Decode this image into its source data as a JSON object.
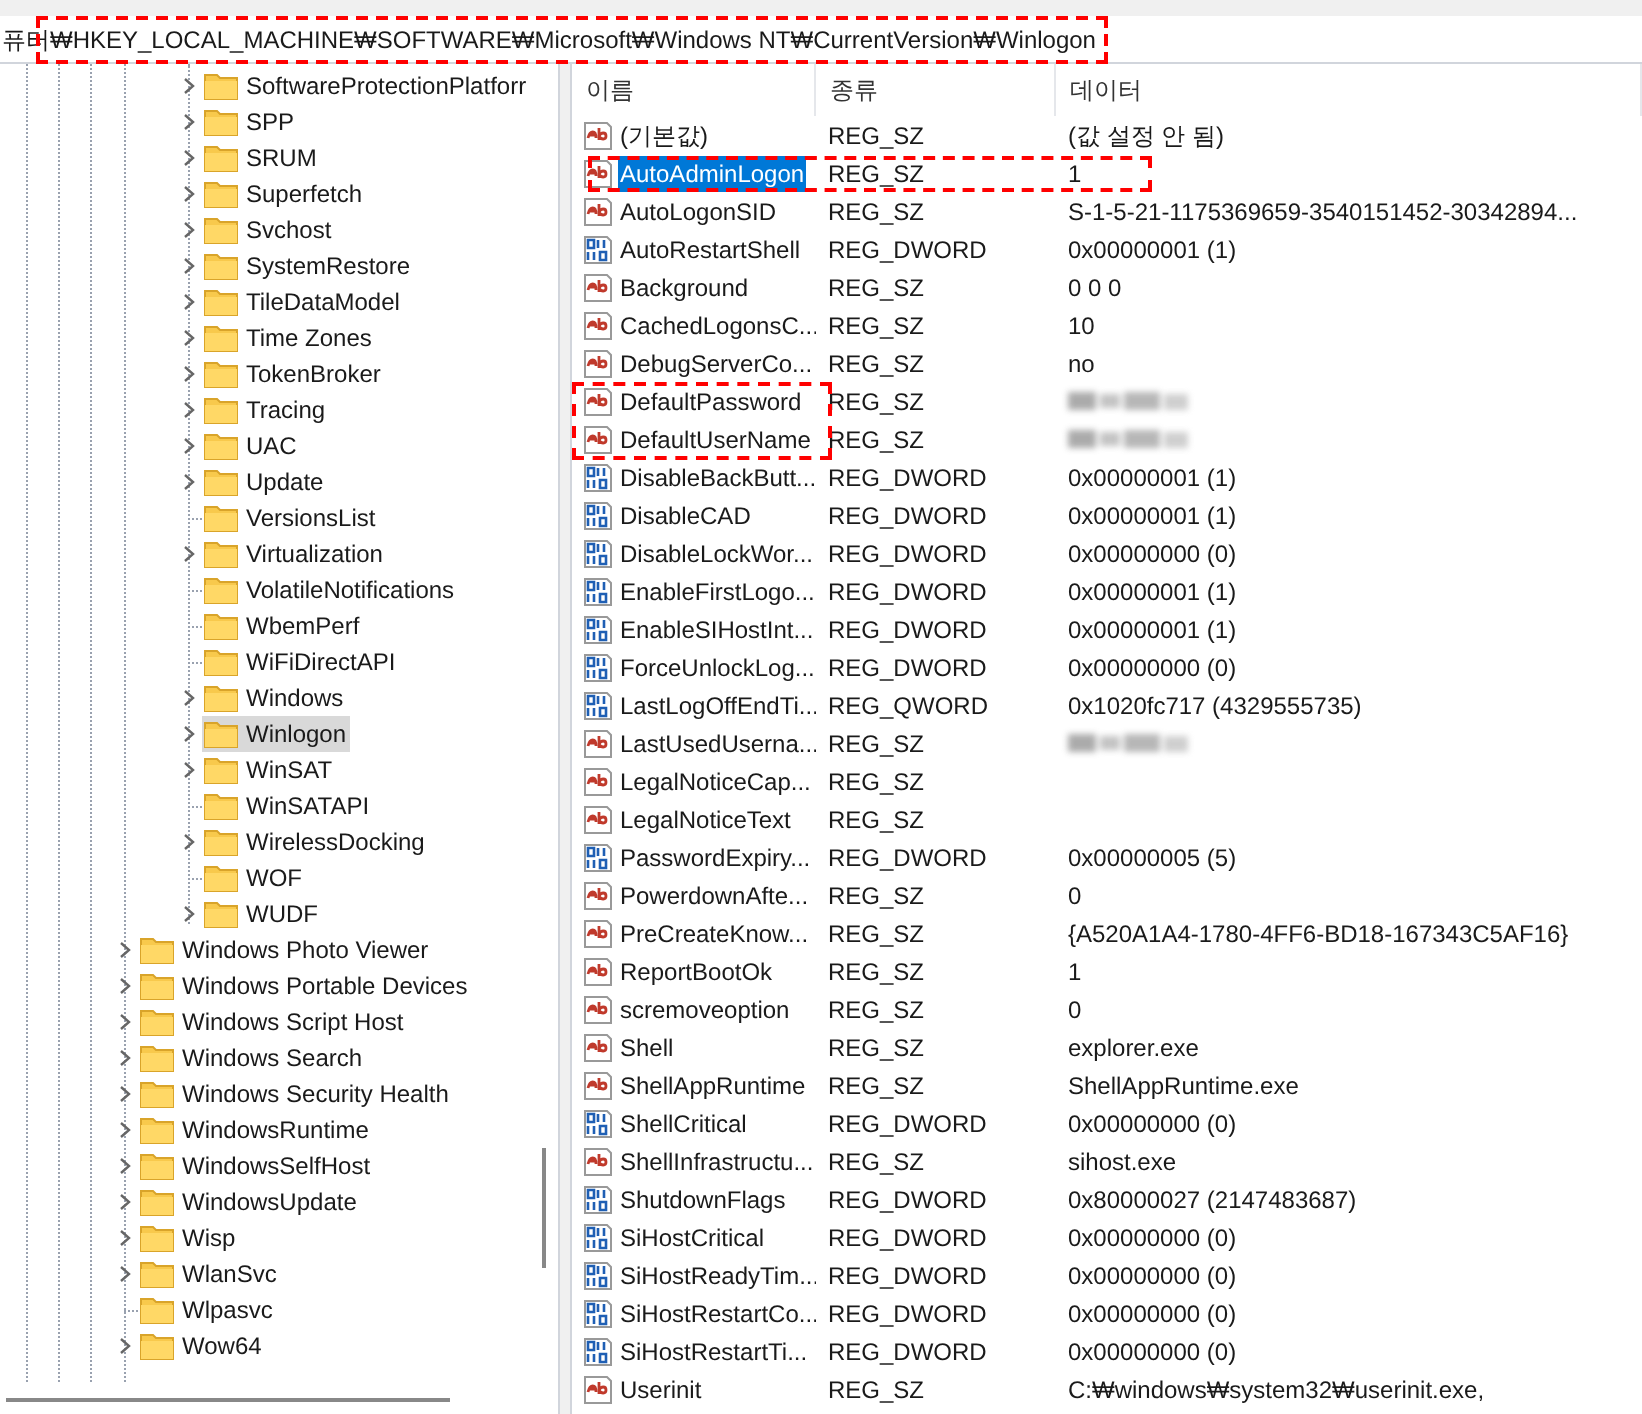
{
  "address_bar": {
    "path": "퓨터₩HKEY_LOCAL_MACHINE₩SOFTWARE₩Microsoft₩Windows NT₩CurrentVersion₩Winlogon",
    "highlighted": true
  },
  "tree": {
    "nested_items": [
      {
        "label": "SoftwareProtectionPlatforr",
        "expandable": true,
        "selected": false
      },
      {
        "label": "SPP",
        "expandable": true,
        "selected": false
      },
      {
        "label": "SRUM",
        "expandable": true,
        "selected": false
      },
      {
        "label": "Superfetch",
        "expandable": true,
        "selected": false
      },
      {
        "label": "Svchost",
        "expandable": true,
        "selected": false
      },
      {
        "label": "SystemRestore",
        "expandable": true,
        "selected": false
      },
      {
        "label": "TileDataModel",
        "expandable": true,
        "selected": false
      },
      {
        "label": "Time Zones",
        "expandable": true,
        "selected": false
      },
      {
        "label": "TokenBroker",
        "expandable": true,
        "selected": false
      },
      {
        "label": "Tracing",
        "expandable": true,
        "selected": false
      },
      {
        "label": "UAC",
        "expandable": true,
        "selected": false
      },
      {
        "label": "Update",
        "expandable": true,
        "selected": false
      },
      {
        "label": "VersionsList",
        "expandable": false,
        "selected": false
      },
      {
        "label": "Virtualization",
        "expandable": true,
        "selected": false
      },
      {
        "label": "VolatileNotifications",
        "expandable": false,
        "selected": false
      },
      {
        "label": "WbemPerf",
        "expandable": false,
        "selected": false
      },
      {
        "label": "WiFiDirectAPI",
        "expandable": false,
        "selected": false
      },
      {
        "label": "Windows",
        "expandable": true,
        "selected": false
      },
      {
        "label": "Winlogon",
        "expandable": true,
        "selected": true
      },
      {
        "label": "WinSAT",
        "expandable": true,
        "selected": false
      },
      {
        "label": "WinSATAPI",
        "expandable": false,
        "selected": false
      },
      {
        "label": "WirelessDocking",
        "expandable": true,
        "selected": false
      },
      {
        "label": "WOF",
        "expandable": false,
        "selected": false
      },
      {
        "label": "WUDF",
        "expandable": true,
        "selected": false
      }
    ],
    "items": [
      {
        "label": "Windows Photo Viewer",
        "expandable": true,
        "selected": false
      },
      {
        "label": "Windows Portable Devices",
        "expandable": true,
        "selected": false
      },
      {
        "label": "Windows Script Host",
        "expandable": true,
        "selected": false
      },
      {
        "label": "Windows Search",
        "expandable": true,
        "selected": false
      },
      {
        "label": "Windows Security Health",
        "expandable": true,
        "selected": false
      },
      {
        "label": "WindowsRuntime",
        "expandable": true,
        "selected": false
      },
      {
        "label": "WindowsSelfHost",
        "expandable": true,
        "selected": false
      },
      {
        "label": "WindowsUpdate",
        "expandable": true,
        "selected": false
      },
      {
        "label": "Wisp",
        "expandable": true,
        "selected": false
      },
      {
        "label": "WlanSvc",
        "expandable": true,
        "selected": false
      },
      {
        "label": "Wlpasvc",
        "expandable": false,
        "selected": false
      },
      {
        "label": "Wow64",
        "expandable": true,
        "selected": false
      }
    ]
  },
  "values": {
    "columns": [
      "이름",
      "종류",
      "데이터"
    ],
    "rows": [
      {
        "kind": "string",
        "name": "(기본값)",
        "type": "REG_SZ",
        "data": "(값 설정 안 됨)",
        "selected": false
      },
      {
        "kind": "string",
        "name": "AutoAdminLogon",
        "type": "REG_SZ",
        "data": "1",
        "selected": true,
        "highlight_row": true
      },
      {
        "kind": "string",
        "name": "AutoLogonSID",
        "type": "REG_SZ",
        "data": "S-1-5-21-1175369659-3540151452-30342894...",
        "selected": false
      },
      {
        "kind": "binary",
        "name": "AutoRestartShell",
        "type": "REG_DWORD",
        "data": "0x00000001 (1)",
        "selected": false
      },
      {
        "kind": "string",
        "name": "Background",
        "type": "REG_SZ",
        "data": "0 0 0",
        "selected": false
      },
      {
        "kind": "string",
        "name": "CachedLogonsC...",
        "type": "REG_SZ",
        "data": "10",
        "selected": false
      },
      {
        "kind": "string",
        "name": "DebugServerCo...",
        "type": "REG_SZ",
        "data": "no",
        "selected": false
      },
      {
        "kind": "string",
        "name": "DefaultPassword",
        "type": "REG_SZ",
        "data_redacted": true,
        "selected": false,
        "highlight_name": true
      },
      {
        "kind": "string",
        "name": "DefaultUserName",
        "type": "REG_SZ",
        "data_redacted": true,
        "selected": false,
        "highlight_name": true
      },
      {
        "kind": "binary",
        "name": "DisableBackButt...",
        "type": "REG_DWORD",
        "data": "0x00000001 (1)",
        "selected": false
      },
      {
        "kind": "binary",
        "name": "DisableCAD",
        "type": "REG_DWORD",
        "data": "0x00000001 (1)",
        "selected": false
      },
      {
        "kind": "binary",
        "name": "DisableLockWor...",
        "type": "REG_DWORD",
        "data": "0x00000000 (0)",
        "selected": false
      },
      {
        "kind": "binary",
        "name": "EnableFirstLogo...",
        "type": "REG_DWORD",
        "data": "0x00000001 (1)",
        "selected": false
      },
      {
        "kind": "binary",
        "name": "EnableSIHostInt...",
        "type": "REG_DWORD",
        "data": "0x00000001 (1)",
        "selected": false
      },
      {
        "kind": "binary",
        "name": "ForceUnlockLog...",
        "type": "REG_DWORD",
        "data": "0x00000000 (0)",
        "selected": false
      },
      {
        "kind": "binary",
        "name": "LastLogOffEndTi...",
        "type": "REG_QWORD",
        "data": "0x1020fc717 (4329555735)",
        "selected": false
      },
      {
        "kind": "string",
        "name": "LastUsedUserna...",
        "type": "REG_SZ",
        "data_redacted": true,
        "selected": false
      },
      {
        "kind": "string",
        "name": "LegalNoticeCap...",
        "type": "REG_SZ",
        "selected": false
      },
      {
        "kind": "string",
        "name": "LegalNoticeText",
        "type": "REG_SZ",
        "selected": false
      },
      {
        "kind": "binary",
        "name": "PasswordExpiry...",
        "type": "REG_DWORD",
        "data": "0x00000005 (5)",
        "selected": false
      },
      {
        "kind": "string",
        "name": "PowerdownAfte...",
        "type": "REG_SZ",
        "data": "0",
        "selected": false
      },
      {
        "kind": "string",
        "name": "PreCreateKnow...",
        "type": "REG_SZ",
        "data": "{A520A1A4-1780-4FF6-BD18-167343C5AF16}",
        "selected": false
      },
      {
        "kind": "string",
        "name": "ReportBootOk",
        "type": "REG_SZ",
        "data": "1",
        "selected": false
      },
      {
        "kind": "string",
        "name": "scremoveoption",
        "type": "REG_SZ",
        "data": "0",
        "selected": false
      },
      {
        "kind": "string",
        "name": "Shell",
        "type": "REG_SZ",
        "data": "explorer.exe",
        "selected": false
      },
      {
        "kind": "string",
        "name": "ShellAppRuntime",
        "type": "REG_SZ",
        "data": "ShellAppRuntime.exe",
        "selected": false
      },
      {
        "kind": "binary",
        "name": "ShellCritical",
        "type": "REG_DWORD",
        "data": "0x00000000 (0)",
        "selected": false
      },
      {
        "kind": "string",
        "name": "ShellInfrastructu...",
        "type": "REG_SZ",
        "data": "sihost.exe",
        "selected": false
      },
      {
        "kind": "binary",
        "name": "ShutdownFlags",
        "type": "REG_DWORD",
        "data": "0x80000027 (2147483687)",
        "selected": false
      },
      {
        "kind": "binary",
        "name": "SiHostCritical",
        "type": "REG_DWORD",
        "data": "0x00000000 (0)",
        "selected": false
      },
      {
        "kind": "binary",
        "name": "SiHostReadyTim...",
        "type": "REG_DWORD",
        "data": "0x00000000 (0)",
        "selected": false
      },
      {
        "kind": "binary",
        "name": "SiHostRestartCo...",
        "type": "REG_DWORD",
        "data": "0x00000000 (0)",
        "selected": false
      },
      {
        "kind": "binary",
        "name": "SiHostRestartTi...",
        "type": "REG_DWORD",
        "data": "0x00000000 (0)",
        "selected": false
      },
      {
        "kind": "string",
        "name": "Userinit",
        "type": "REG_SZ",
        "data": "C:₩windows₩system32₩userinit.exe,",
        "selected": false
      }
    ]
  }
}
